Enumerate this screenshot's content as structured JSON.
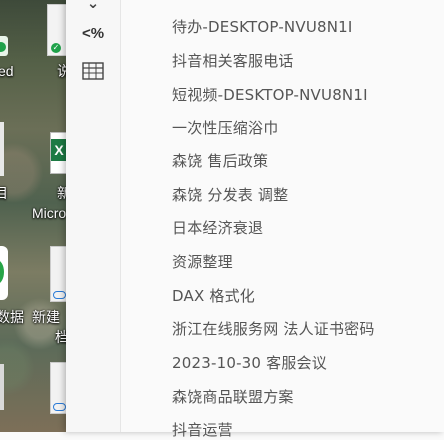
{
  "desktop": {
    "labels": [
      "ed",
      "说",
      "目",
      "新",
      "Micro",
      "数据",
      "新建",
      "档"
    ]
  },
  "app": {
    "tools": [
      {
        "name": "percent-format-icon",
        "glyph": "<%"
      },
      {
        "name": "table-icon",
        "glyph": ""
      }
    ],
    "items": [
      "待办-DESKTOP-NVU8N1I",
      "抖音相关客服电话",
      "短视频-DESKTOP-NVU8N1I",
      "一次性压缩浴巾",
      "森饶 售后政策",
      "森饶 分发表 调整",
      "日本经济衰退",
      "资源整理",
      "DAX 格式化",
      "浙江在线服务网 法人证书密码",
      "2023-10-30 客服会议",
      "森饶商品联盟方案",
      "抖音运营"
    ]
  }
}
